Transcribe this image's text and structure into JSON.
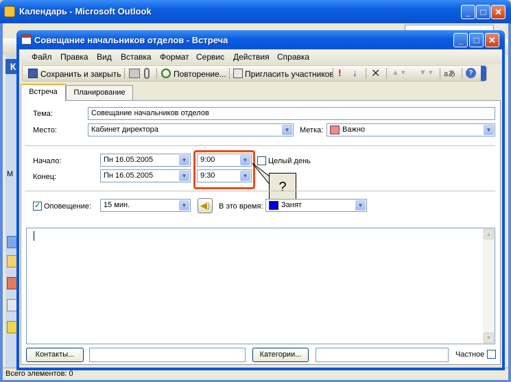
{
  "outer_window": {
    "title": "Календарь - Microsoft Outlook",
    "status": "Всего элементов: 0",
    "left_letter": "К",
    "left_letter2": "М"
  },
  "dialog": {
    "title": "Совещание начальников отделов - Встреча",
    "menu": [
      "Файл",
      "Правка",
      "Вид",
      "Вставка",
      "Формат",
      "Сервис",
      "Действия",
      "Справка"
    ],
    "toolbar": {
      "save_close": "Сохранить и закрыть",
      "recurrence": "Повторение...",
      "invite": "Пригласить участников"
    },
    "tabs": [
      "Встреча",
      "Планирование"
    ],
    "form": {
      "subject_label": "Тема:",
      "subject_value": "Совещание начальников отделов",
      "location_label": "Место:",
      "location_value": "Кабинет директора",
      "label_label": "Метка:",
      "label_value": "Важно",
      "label_color": "#f28a85",
      "start_label": "Начало:",
      "start_date": "Пн 16.05.2005",
      "start_time": "9:00",
      "allday_label": "Целый день",
      "end_label": "Конец:",
      "end_date": "Пн 16.05.2005",
      "end_time": "9:30",
      "reminder_label": "Оповещение:",
      "reminder_value": "15 мин.",
      "show_as_label": "В это время:",
      "show_as_value": "Занят",
      "show_as_color": "#0000e0"
    },
    "footer": {
      "contacts": "Контакты...",
      "categories": "Категории...",
      "private": "Частное"
    },
    "callout": "?"
  },
  "colors": {
    "highlight": "#e84b17",
    "title_bar": "#0a5fe0"
  }
}
